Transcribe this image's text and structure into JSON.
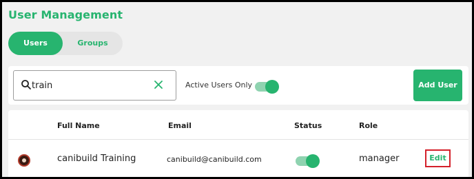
{
  "page": {
    "title": "User Management"
  },
  "tabs": [
    {
      "label": "Users",
      "active": true
    },
    {
      "label": "Groups",
      "active": false
    }
  ],
  "toolbar": {
    "search_value": "train",
    "search_icon": "search-icon",
    "clear_icon": "close-icon",
    "active_filter_label": "Active Users Only",
    "active_filter_on": true,
    "add_user_label": "Add User"
  },
  "table": {
    "columns": [
      "Full Name",
      "Email",
      "Status",
      "Role"
    ],
    "rows": [
      {
        "full_name": "canibuild Training",
        "email": "canibuild@canibuild.com",
        "status_on": true,
        "role": "manager",
        "edit_label": "Edit"
      }
    ]
  },
  "colors": {
    "accent": "#27b46f",
    "accent_light": "#8fd3b0",
    "highlight_border": "#d4202a",
    "background": "#f1f1f1"
  }
}
